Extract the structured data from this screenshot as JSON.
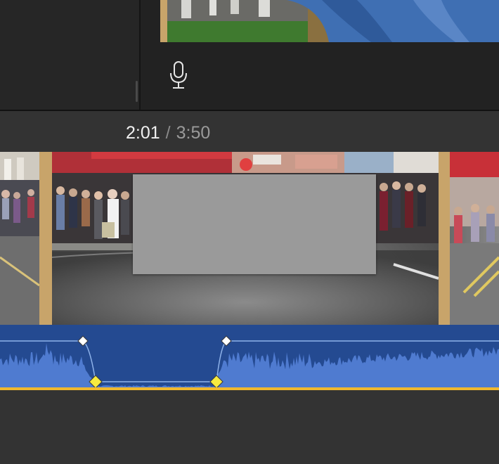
{
  "timecode": {
    "current": "2:01",
    "separator": "/",
    "total": "3:50"
  },
  "icons": {
    "voiceover": "microphone-icon"
  },
  "colors": {
    "audio_clip": "#244a91",
    "waveform": "#4f7bd0",
    "volume_line": "#8fb3ea",
    "keyframe_selected": "#f6ea3f",
    "keyframe": "#ffffff",
    "baseline": "#f0b82d",
    "frame_border": "#c8a46a"
  }
}
